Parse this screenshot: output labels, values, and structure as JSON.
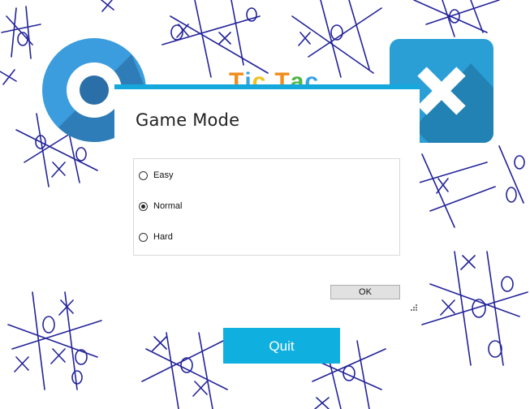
{
  "colors": {
    "accent": "#14a8dc",
    "quit_bg": "#0fb0e0",
    "sketch": "#23239a"
  },
  "background": {
    "icon": "tic-tac-toe-doodles"
  },
  "logos": {
    "o_icon": "o-logo-icon",
    "x_icon": "x-logo-icon"
  },
  "game_title": {
    "letters": [
      "T",
      "i",
      "c",
      "T",
      "a",
      "c"
    ],
    "colors": [
      "#f28c1c",
      "#3aa3e3",
      "#f2c21c",
      "#f28c1c",
      "#4fb848",
      "#3aa3e3"
    ]
  },
  "dialog": {
    "title": "Game Mode",
    "options": [
      {
        "label": "Easy",
        "checked": false
      },
      {
        "label": "Normal",
        "checked": true
      },
      {
        "label": "Hard",
        "checked": false
      }
    ],
    "ok_label": "OK"
  },
  "quit_label": "Quit"
}
